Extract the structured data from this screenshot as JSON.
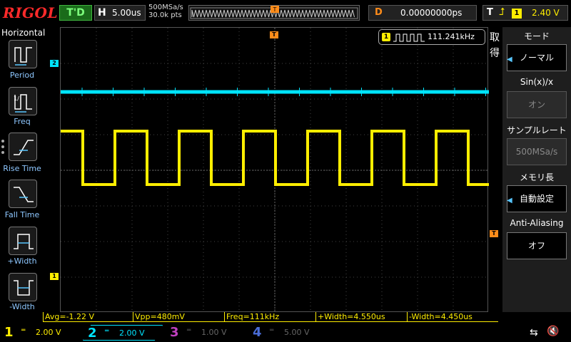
{
  "brand": "RIGOL",
  "trigger_status": "T'D",
  "horizontal": {
    "label": "H",
    "timebase": "5.00us"
  },
  "sample": {
    "rate": "500MSa/s",
    "points": "30.0k pts"
  },
  "delay": {
    "label": "D",
    "value": "0.00000000ps"
  },
  "trigger": {
    "label": "T",
    "edge_icon": "rising-edge-icon",
    "edge_glyph": "⮥",
    "channel": "1",
    "level": "2.40 V"
  },
  "left_menu": {
    "title": "Horizontal",
    "items": [
      {
        "label": "Period",
        "icon": "period-icon"
      },
      {
        "label": "Freq",
        "icon": "freq-icon"
      },
      {
        "label": "Rise Time",
        "icon": "rise-time-icon"
      },
      {
        "label": "Fall Time",
        "icon": "fall-time-icon"
      },
      {
        "label": "+Width",
        "icon": "pos-width-icon"
      },
      {
        "label": "-Width",
        "icon": "neg-width-icon"
      }
    ]
  },
  "freq_counter": {
    "channel": "1",
    "value": "111.241kHz"
  },
  "right_menu": {
    "tab_label": "取得",
    "items": [
      {
        "header": "モード",
        "value": "ノーマル",
        "state": "active"
      },
      {
        "header": "Sin(x)/x",
        "value": "オン",
        "state": "disabled"
      },
      {
        "header": "サンプルレート",
        "value": "500MSa/s",
        "state": "disabled"
      },
      {
        "header": "メモリ長",
        "value": "自動設定",
        "state": "active"
      },
      {
        "header": "Anti-Aliasing",
        "value": "オフ",
        "state": "active"
      }
    ]
  },
  "measurements": [
    {
      "text": "Avg=-1.22 V"
    },
    {
      "text": "Vpp=480mV"
    },
    {
      "text": "Freq=111kHz"
    },
    {
      "text": "+Width=4.550us"
    },
    {
      "text": "-Width=4.450us"
    }
  ],
  "channels": [
    {
      "num": "1",
      "coupling": "═",
      "scale": "2.00 V",
      "color": "#ffee00",
      "active": true
    },
    {
      "num": "2",
      "coupling": "═",
      "scale": "2.00 V",
      "color": "#00e5ff",
      "active": true
    },
    {
      "num": "3",
      "coupling": "═",
      "scale": "1.00 V",
      "color": "#c040c0",
      "active": false
    },
    {
      "num": "4",
      "coupling": "═",
      "scale": "5.00 V",
      "color": "#4a6dd8",
      "active": false
    }
  ],
  "waveform": {
    "ch1": {
      "high_div": 5.1,
      "low_div": 3.6,
      "period_div": 1.8,
      "start_phase_div": 1.0
    },
    "ch2": {
      "level_div": 1.8
    }
  },
  "colors": {
    "ch1": "#ffee00",
    "ch2": "#00e5ff",
    "trigger": "#ff8c1a",
    "accent": "#58c6ff"
  }
}
